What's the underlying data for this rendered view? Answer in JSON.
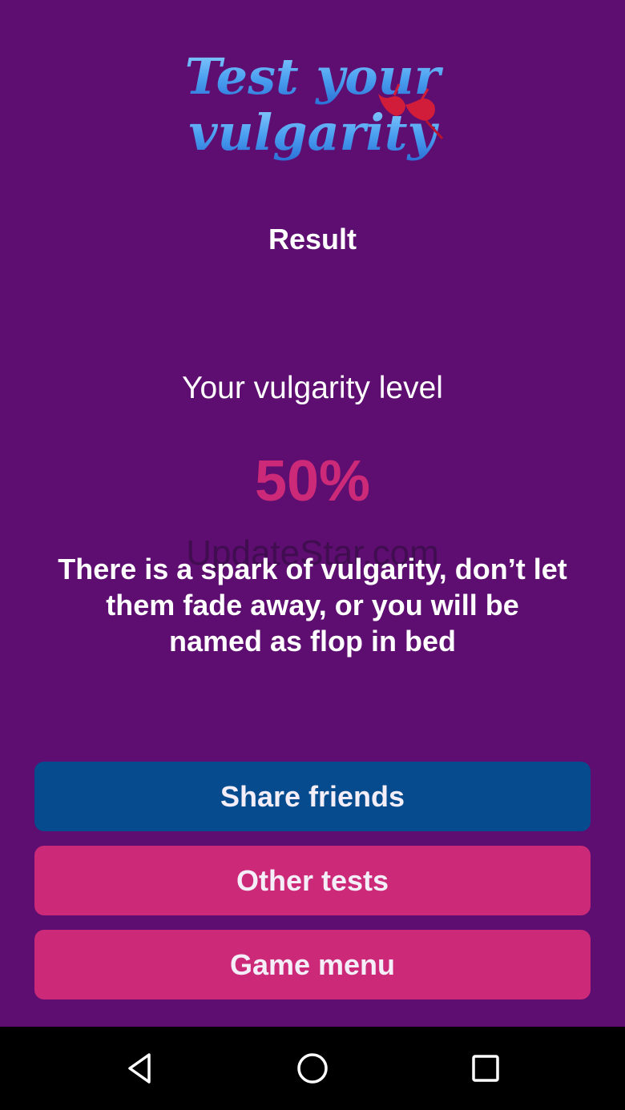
{
  "logo": {
    "line1": "Test your",
    "line2": "vulgarity"
  },
  "screen": {
    "title": "Result"
  },
  "result": {
    "level_label": "Your vulgarity level",
    "level_value": "50%",
    "description": "There is a spark of vulgarity, don’t let them fade away, or you will be named as flop in bed"
  },
  "watermark": "UpdateStar.com",
  "buttons": {
    "share": "Share friends",
    "other_tests": "Other tests",
    "game_menu": "Game menu"
  },
  "colors": {
    "background": "#5e0d70",
    "accent_pink": "#cc2a79",
    "share_blue": "#054b8e",
    "navbar": "#000000"
  },
  "navbar": {
    "icons": [
      "back-triangle-icon",
      "home-circle-icon",
      "recents-square-icon"
    ]
  }
}
